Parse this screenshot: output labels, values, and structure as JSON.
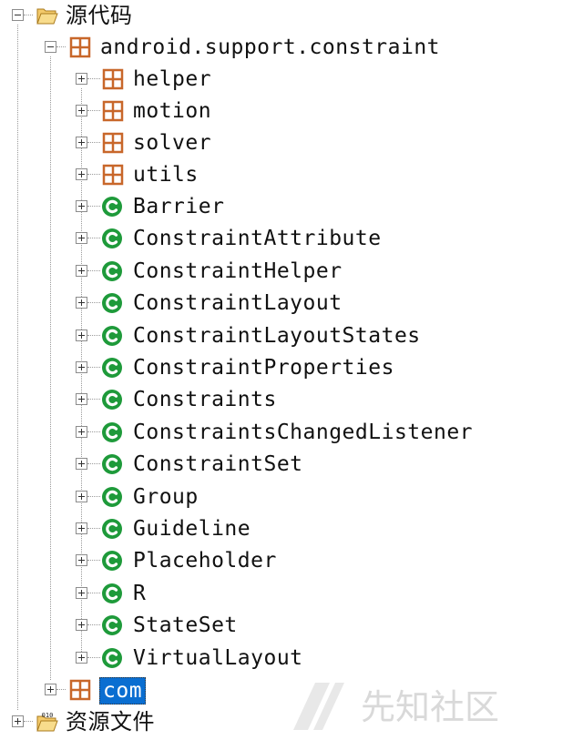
{
  "tree": {
    "root": {
      "label": "源代码",
      "icon": "folder-open-icon",
      "expanded": true
    },
    "package": {
      "label": "android.support.constraint",
      "icon": "package-icon",
      "expanded": true
    },
    "subpackages": [
      {
        "label": "helper",
        "icon": "package-icon"
      },
      {
        "label": "motion",
        "icon": "package-icon"
      },
      {
        "label": "solver",
        "icon": "package-icon"
      },
      {
        "label": "utils",
        "icon": "package-icon"
      }
    ],
    "classes": [
      {
        "label": "Barrier",
        "icon": "class-icon"
      },
      {
        "label": "ConstraintAttribute",
        "icon": "class-icon"
      },
      {
        "label": "ConstraintHelper",
        "icon": "class-icon"
      },
      {
        "label": "ConstraintLayout",
        "icon": "class-icon"
      },
      {
        "label": "ConstraintLayoutStates",
        "icon": "class-icon"
      },
      {
        "label": "ConstraintProperties",
        "icon": "class-icon"
      },
      {
        "label": "Constraints",
        "icon": "class-icon"
      },
      {
        "label": "ConstraintsChangedListener",
        "icon": "class-icon"
      },
      {
        "label": "ConstraintSet",
        "icon": "class-icon"
      },
      {
        "label": "Group",
        "icon": "class-icon"
      },
      {
        "label": "Guideline",
        "icon": "class-icon"
      },
      {
        "label": "Placeholder",
        "icon": "class-icon"
      },
      {
        "label": "R",
        "icon": "class-icon"
      },
      {
        "label": "StateSet",
        "icon": "class-icon"
      },
      {
        "label": "VirtualLayout",
        "icon": "class-icon"
      }
    ],
    "com": {
      "label": "com",
      "icon": "package-icon",
      "selected": true
    },
    "resources": {
      "label": "资源文件",
      "icon": "folder-binary-icon"
    }
  },
  "watermark": {
    "text": "先知社区"
  },
  "colors": {
    "selection": "#0a6ed1",
    "class_icon": "#1e9a3a",
    "package_icon": "#c8672a",
    "folder_icon": "#e8b43a"
  }
}
